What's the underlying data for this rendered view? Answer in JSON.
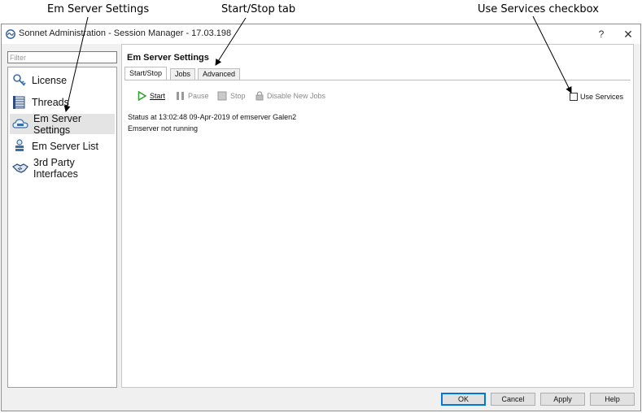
{
  "annotations": {
    "em_server_settings": "Em Server Settings",
    "start_stop_tab": "Start/Stop tab",
    "use_services_checkbox": "Use Services checkbox"
  },
  "window": {
    "title": "Sonnet Administration - Session Manager - 17.03.198",
    "help": "?",
    "close": "✕"
  },
  "sidebar": {
    "filter_placeholder": "Filter",
    "filter_value": "",
    "items": [
      {
        "label": "License",
        "icon": "key-icon"
      },
      {
        "label": "Threads",
        "icon": "threads-icon"
      },
      {
        "label": "Em Server Settings",
        "icon": "cloud-server-icon",
        "selected": true
      },
      {
        "label": "Em Server List",
        "icon": "server-list-icon"
      },
      {
        "label": "3rd Party Interfaces",
        "icon": "handshake-icon"
      }
    ]
  },
  "main": {
    "section_title": "Em Server Settings",
    "tabs": [
      {
        "label": "Start/Stop",
        "active": true
      },
      {
        "label": "Jobs",
        "active": false
      },
      {
        "label": "Advanced",
        "active": false
      }
    ],
    "toolbar": {
      "start": "Start",
      "pause": "Pause",
      "stop": "Stop",
      "disable_new_jobs": "Disable New Jobs"
    },
    "use_services_label": "Use Services",
    "use_services_checked": false,
    "status_line_1": "Status at 13:02:48  09-Apr-2019 of emserver Galen2",
    "status_line_2": "Emserver not running"
  },
  "buttons": {
    "ok": "OK",
    "cancel": "Cancel",
    "apply": "Apply",
    "help": "Help"
  },
  "colors": {
    "start_green": "#2a9d2a",
    "default_button_border": "#0078d7",
    "selected_item_bg": "#e4e4e4"
  }
}
